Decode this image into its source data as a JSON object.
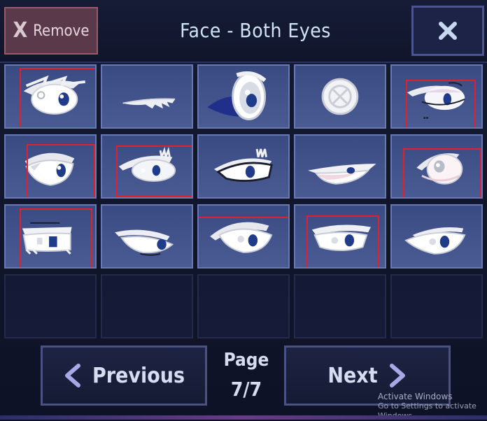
{
  "header": {
    "remove_icon": "X",
    "remove_label": "Remove",
    "title": "Face - Both Eyes",
    "close_icon": "close-icon"
  },
  "grid": {
    "columns": 5,
    "rows": 4,
    "items": [
      {
        "icon": "eye-style-1",
        "highlighted": true
      },
      {
        "icon": "eye-style-closed",
        "highlighted": false
      },
      {
        "icon": "eye-style-dark-blue",
        "highlighted": false
      },
      {
        "icon": "no-eye-icon",
        "highlighted": false
      },
      {
        "icon": "eye-style-5",
        "highlighted": true
      },
      {
        "icon": "eye-style-6",
        "highlighted": true
      },
      {
        "icon": "eye-style-7",
        "highlighted": true
      },
      {
        "icon": "eye-style-8",
        "highlighted": false
      },
      {
        "icon": "eye-style-9",
        "highlighted": false
      },
      {
        "icon": "eye-style-10",
        "highlighted": true
      },
      {
        "icon": "eye-style-11",
        "highlighted": true
      },
      {
        "icon": "eye-style-12",
        "highlighted": false
      },
      {
        "icon": "eye-style-13",
        "highlighted": true
      },
      {
        "icon": "eye-style-14",
        "highlighted": true
      },
      {
        "icon": "eye-style-15",
        "highlighted": false
      }
    ]
  },
  "footer": {
    "previous_label": "Previous",
    "next_label": "Next",
    "page_label": "Page",
    "page_value": "7/7"
  },
  "watermark": {
    "line1": "Activate Windows",
    "line2": "Go to Settings to activate Windows."
  },
  "colors": {
    "highlight": "#e0202a",
    "slot_bg": "#3a4a82",
    "accent_arrow": "#a7a8e8"
  }
}
